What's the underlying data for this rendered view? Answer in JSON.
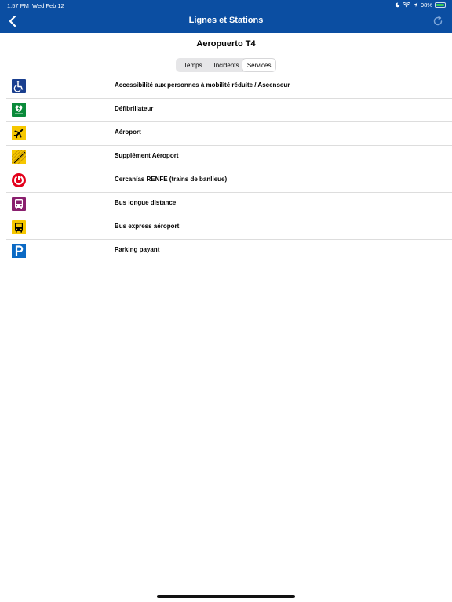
{
  "status_bar": {
    "time": "1:57 PM",
    "date": "Wed Feb 12",
    "battery": "98%",
    "battery_level": 0.98
  },
  "nav": {
    "title": "Lignes et Stations",
    "back_icon": "chevron-left-icon",
    "refresh_icon": "refresh-icon"
  },
  "station": {
    "name": "Aeropuerto T4"
  },
  "tabs": [
    {
      "label": "Temps",
      "selected": false
    },
    {
      "label": "Incidents",
      "selected": false
    },
    {
      "label": "Services",
      "selected": true
    }
  ],
  "services": [
    {
      "label": "Accessibilité aux personnes à mobilité réduite / Ascenseur",
      "icon": "wheelchair-icon",
      "color": "#1a3f8f"
    },
    {
      "label": "Défibrillateur",
      "icon": "defibrillator-icon",
      "color": "#0a8a3a"
    },
    {
      "label": "Aéroport",
      "icon": "airplane-icon",
      "color": "#f6c700"
    },
    {
      "label": "Supplément Aéroport",
      "icon": "airport-supplement-icon",
      "color": "#f6c700"
    },
    {
      "label": "Cercanías RENFE (trains de banlieue)",
      "icon": "renfe-cercanias-icon",
      "color": "#e3001b"
    },
    {
      "label": "Bus longue distance",
      "icon": "long-distance-bus-icon",
      "color": "#8a1f6e"
    },
    {
      "label": "Bus express aéroport",
      "icon": "airport-express-bus-icon",
      "color": "#f6c700"
    },
    {
      "label": "Parking payant",
      "icon": "parking-icon",
      "color": "#0a69c4"
    }
  ],
  "colors": {
    "header": "#0b4ea2",
    "separator": "#dddddd"
  }
}
